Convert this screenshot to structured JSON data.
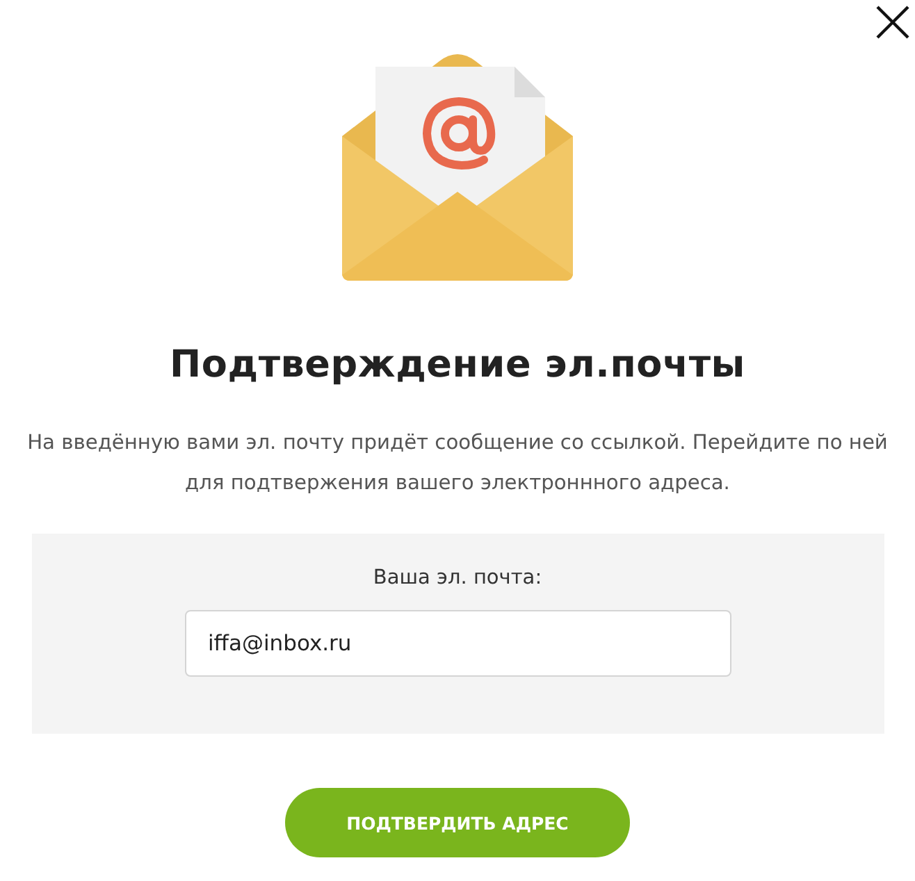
{
  "title": "Подтверждение эл.почты",
  "description": "На введённую вами эл. почту придёт сообщение со ссылкой. Перейдите по ней для подтвержения вашего электроннного адреса.",
  "email_field": {
    "label": "Ваша эл. почта:",
    "value": "iffa@inbox.ru"
  },
  "buttons": [
    "ПОДТВЕРДИТЬ АДРЕС"
  ]
}
